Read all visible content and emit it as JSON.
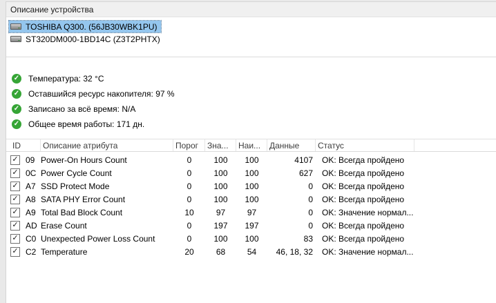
{
  "header": {
    "title": "Описание устройства"
  },
  "devices": [
    {
      "label": "TOSHIBA Q300. (56JB30WBK1PU)",
      "selected": true
    },
    {
      "label": "ST320DM000-1BD14C (Z3T2PHTX)",
      "selected": false
    }
  ],
  "summary": [
    {
      "icon": "check-circle",
      "label": "Температура: 32 °C"
    },
    {
      "icon": "check-circle",
      "label": "Оставшийся ресурс накопителя: 97 %"
    },
    {
      "icon": "check-circle",
      "label": "Записано за всё время: N/A"
    },
    {
      "icon": "check-circle",
      "label": "Общее время работы: 171 дн."
    }
  ],
  "table": {
    "columns": [
      "ID",
      "Описание атрибута",
      "Порог",
      "Зна...",
      "Наи...",
      "Данные",
      "Статус"
    ],
    "rows": [
      {
        "checked": true,
        "id": "09",
        "name": "Power-On Hours Count",
        "threshold": "0",
        "value": "100",
        "worst": "100",
        "data": "4107",
        "status": "OK: Всегда пройдено"
      },
      {
        "checked": true,
        "id": "0C",
        "name": "Power Cycle Count",
        "threshold": "0",
        "value": "100",
        "worst": "100",
        "data": "627",
        "status": "OK: Всегда пройдено"
      },
      {
        "checked": true,
        "id": "A7",
        "name": "SSD Protect Mode",
        "threshold": "0",
        "value": "100",
        "worst": "100",
        "data": "0",
        "status": "OK: Всегда пройдено"
      },
      {
        "checked": true,
        "id": "A8",
        "name": "SATA PHY Error Count",
        "threshold": "0",
        "value": "100",
        "worst": "100",
        "data": "0",
        "status": "OK: Всегда пройдено"
      },
      {
        "checked": true,
        "id": "A9",
        "name": "Total Bad Block Count",
        "threshold": "10",
        "value": "97",
        "worst": "97",
        "data": "0",
        "status": "OK: Значение нормал..."
      },
      {
        "checked": true,
        "id": "AD",
        "name": "Erase Count",
        "threshold": "0",
        "value": "197",
        "worst": "197",
        "data": "0",
        "status": "OK: Всегда пройдено"
      },
      {
        "checked": true,
        "id": "C0",
        "name": "Unexpected Power Loss Count",
        "threshold": "0",
        "value": "100",
        "worst": "100",
        "data": "83",
        "status": "OK: Всегда пройдено"
      },
      {
        "checked": true,
        "id": "C2",
        "name": "Temperature",
        "threshold": "20",
        "value": "68",
        "worst": "54",
        "data": "46, 18, 32",
        "status": "OK: Значение нормал..."
      }
    ]
  },
  "colors": {
    "selection_blue": "#94c6ee",
    "status_ok_green": "#36a536"
  },
  "icons": {
    "check_glyph": "✓"
  }
}
